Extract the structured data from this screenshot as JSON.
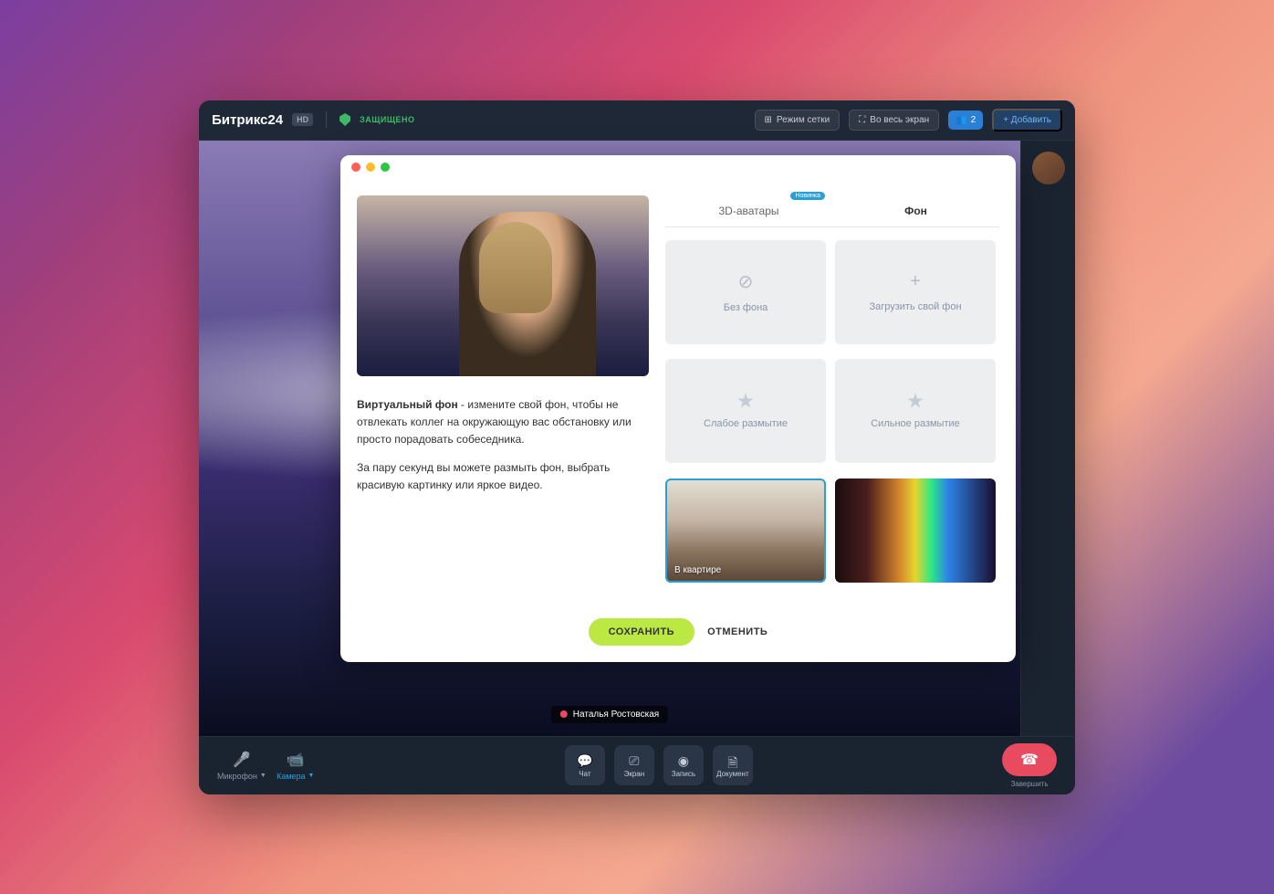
{
  "topbar": {
    "logo": "Битрикс24",
    "hd_badge": "HD",
    "protected": "ЗАЩИЩЕНО",
    "grid_mode": "Режим сетки",
    "fullscreen": "Во весь экран",
    "participants_count": "2",
    "add_button": "+ Добавить"
  },
  "participant": {
    "name": "Наталья Ростовская"
  },
  "bottombar": {
    "mic": "Микрофон",
    "camera": "Камера",
    "chat": "Чат",
    "screen": "Экран",
    "record": "Запись",
    "document": "Документ",
    "end": "Завершить"
  },
  "modal": {
    "tabs": {
      "avatars": "3D-аватары",
      "avatars_badge": "Новинка",
      "background": "Фон"
    },
    "description": {
      "bold": "Виртуальный фон",
      "text1": " - измените свой фон, чтобы не отвлекать коллег на окружающую вас обстановку или просто порадовать собеседника.",
      "text2": "За пару секунд вы можете размыть фон, выбрать красивую картинку или яркое видео."
    },
    "options": {
      "none": "Без фона",
      "upload": "Загрузить свой фон",
      "blur_light": "Слабое размытие",
      "blur_strong": "Сильное размытие",
      "apartment": "В квартире"
    },
    "footer": {
      "save": "СОХРАНИТЬ",
      "cancel": "ОТМЕНИТЬ"
    }
  }
}
